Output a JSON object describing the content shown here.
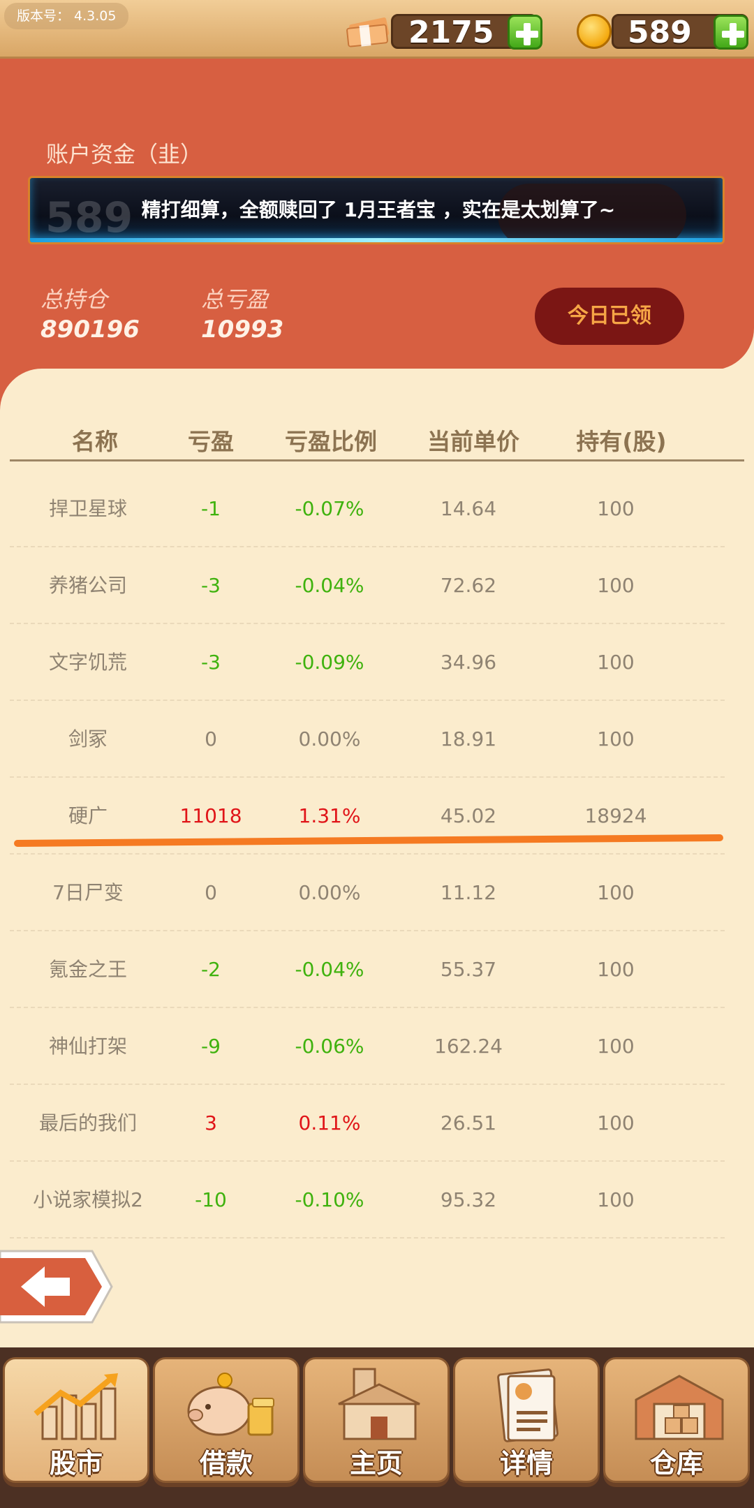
{
  "version_label": "版本号： 4.3.05",
  "resources": {
    "cash": "2175",
    "coins": "589"
  },
  "account": {
    "label": "账户资金（韭）",
    "banner_ghost": "589",
    "banner_message": "精打细算，全额赎回了 1月王者宝 ，实在是太划算了~",
    "total_position_label": "总持仓",
    "total_position_value": "890196",
    "total_pnl_label": "总亏盈",
    "total_pnl_value": "10993",
    "claim_button": "今日已领"
  },
  "table": {
    "headers": [
      "名称",
      "亏盈",
      "亏盈比例",
      "当前单价",
      "持有(股)"
    ],
    "rows": [
      {
        "name": "捍卫星球",
        "pnl": "-1",
        "ratio": "-0.07%",
        "price": "14.64",
        "hold": "100",
        "trend": "down"
      },
      {
        "name": "养猪公司",
        "pnl": "-3",
        "ratio": "-0.04%",
        "price": "72.62",
        "hold": "100",
        "trend": "down"
      },
      {
        "name": "文字饥荒",
        "pnl": "-3",
        "ratio": "-0.09%",
        "price": "34.96",
        "hold": "100",
        "trend": "down"
      },
      {
        "name": "剑冢",
        "pnl": "0",
        "ratio": "0.00%",
        "price": "18.91",
        "hold": "100",
        "trend": "flat"
      },
      {
        "name": "硬广",
        "pnl": "11018",
        "ratio": "1.31%",
        "price": "45.02",
        "hold": "18924",
        "trend": "up"
      },
      {
        "name": "7日尸变",
        "pnl": "0",
        "ratio": "0.00%",
        "price": "11.12",
        "hold": "100",
        "trend": "flat"
      },
      {
        "name": "氪金之王",
        "pnl": "-2",
        "ratio": "-0.04%",
        "price": "55.37",
        "hold": "100",
        "trend": "down"
      },
      {
        "name": "神仙打架",
        "pnl": "-9",
        "ratio": "-0.06%",
        "price": "162.24",
        "hold": "100",
        "trend": "down"
      },
      {
        "name": "最后的我们",
        "pnl": "3",
        "ratio": "0.11%",
        "price": "26.51",
        "hold": "100",
        "trend": "up"
      },
      {
        "name": "小说家模拟2",
        "pnl": "-10",
        "ratio": "-0.10%",
        "price": "95.32",
        "hold": "100",
        "trend": "down"
      }
    ]
  },
  "nav": [
    {
      "label": "股市",
      "icon": "stock-chart-icon",
      "active": true
    },
    {
      "label": "借款",
      "icon": "piggy-bank-icon",
      "active": false
    },
    {
      "label": "主页",
      "icon": "home-building-icon",
      "active": false
    },
    {
      "label": "详情",
      "icon": "profile-card-icon",
      "active": false
    },
    {
      "label": "仓库",
      "icon": "warehouse-icon",
      "active": false
    }
  ],
  "colors": {
    "header_red": "#d75f41",
    "cream": "#fbeccd",
    "gain_red": "#e01418",
    "loss_green": "#3fb20e",
    "highlight": "#f57a22"
  }
}
